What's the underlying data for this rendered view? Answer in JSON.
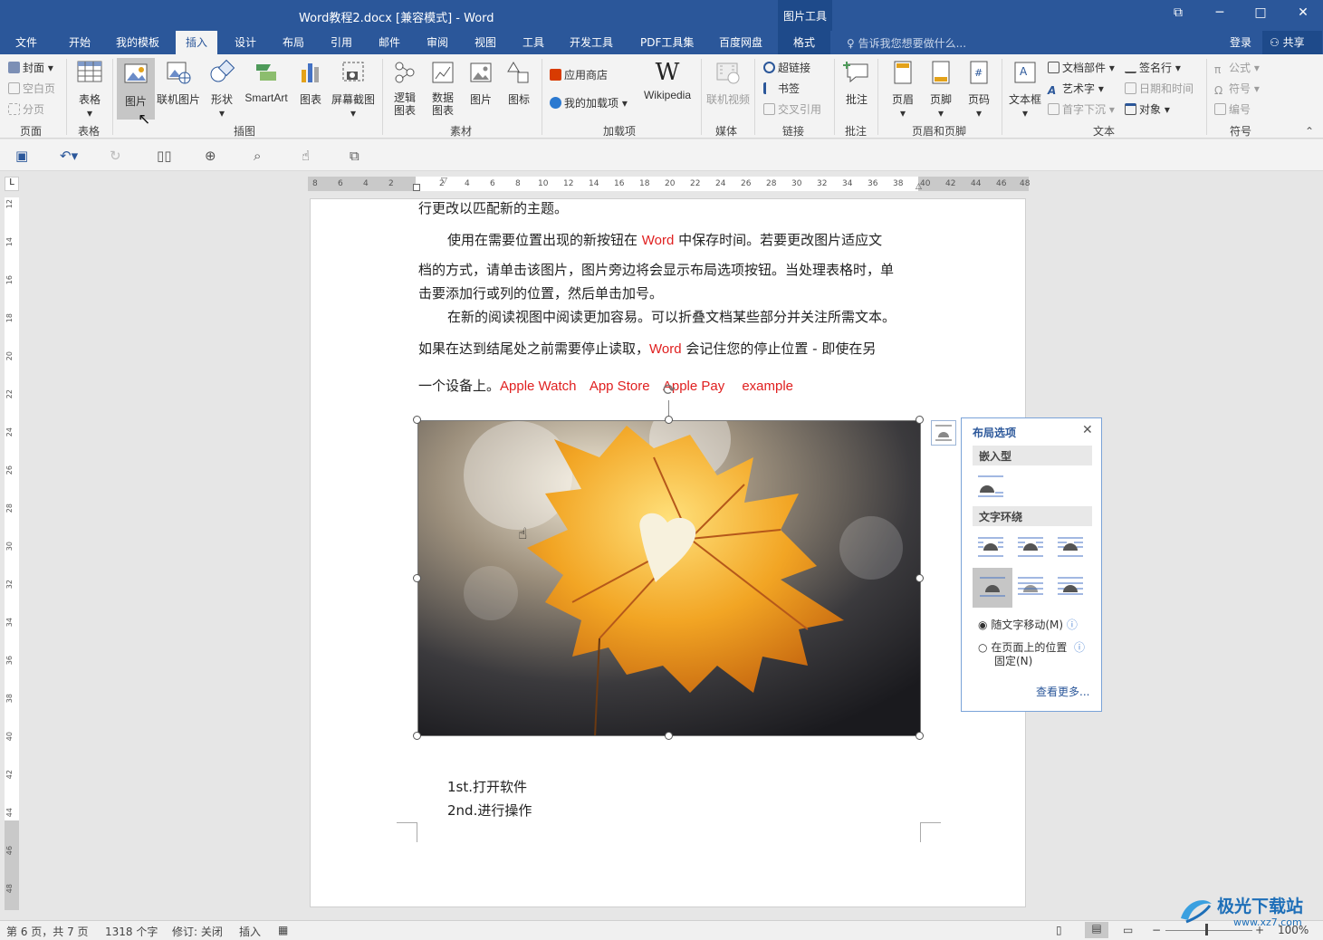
{
  "window": {
    "title": "Word教程2.docx [兼容模式] - Word",
    "context_tab": "图片工具",
    "restore_icon": "⧉",
    "minimize_icon": "─",
    "maximize_icon": "□",
    "close_icon": "✕"
  },
  "tabs": [
    "文件",
    "开始",
    "我的模板",
    "插入",
    "设计",
    "布局",
    "引用",
    "邮件",
    "审阅",
    "视图",
    "工具",
    "开发工具",
    "PDF工具集",
    "百度网盘"
  ],
  "format_tab": "格式",
  "tell_me": "告诉我您想要做什么...",
  "login": "登录",
  "share": "共享",
  "ribbon": {
    "pages": {
      "cover": "封面",
      "blank": "空白页",
      "break": "分页",
      "label": "页面"
    },
    "table": {
      "table": "表格",
      "label": "表格"
    },
    "illus": {
      "picture": "图片",
      "online": "联机图片",
      "shapes": "形状",
      "smartart": "SmartArt",
      "chart": "图表",
      "screenshot": "屏幕截图",
      "label": "插图"
    },
    "material": {
      "logic": "逻辑\n图表",
      "data": "数据\n图表",
      "picture": "图片",
      "icon": "图标",
      "label": "素材"
    },
    "addins": {
      "store": "应用商店",
      "mine": "我的加载项",
      "wiki": "Wikipedia",
      "label": "加载项"
    },
    "media": {
      "video": "联机视频",
      "label": "媒体"
    },
    "links": {
      "hyper": "超链接",
      "bookmark": "书签",
      "cross": "交叉引用",
      "label": "链接"
    },
    "comments": {
      "comment": "批注",
      "label": "批注"
    },
    "hf": {
      "header": "页眉",
      "footer": "页脚",
      "number": "页码",
      "label": "页眉和页脚"
    },
    "text": {
      "textbox": "文本框",
      "parts": "文档部件",
      "wordart": "艺术字",
      "dropcap": "首字下沉",
      "sign": "签名行",
      "datetime": "日期和时间",
      "object": "对象",
      "label": "文本"
    },
    "symbols": {
      "equation": "公式",
      "symbol": "符号",
      "number": "编号",
      "label": "符号"
    }
  },
  "ruler_h": [
    "8",
    "6",
    "4",
    "2",
    "",
    "2",
    "4",
    "6",
    "8",
    "10",
    "12",
    "14",
    "16",
    "18",
    "20",
    "22",
    "24",
    "26",
    "28",
    "30",
    "32",
    "34",
    "36",
    "38",
    "40",
    "42",
    "44",
    "46",
    "48"
  ],
  "ruler_v": [
    "12",
    "14",
    "16",
    "18",
    "20",
    "22",
    "24",
    "26",
    "28",
    "30",
    "32",
    "34",
    "36",
    "38",
    "40",
    "42",
    "44",
    "46",
    "48"
  ],
  "doc": {
    "l1": "行更改以匹配新的主题。",
    "l2a": "使用在需要位置出现的新按钮在",
    "l2w": "Word",
    "l2b": "中保存时间。若要更改图片适应文",
    "l3": "档的方式，请单击该图片，图片旁边将会显示布局选项按钮。当处理表格时，单",
    "l4": "击要添加行或列的位置，然后单击加号。",
    "l5": "在新的阅读视图中阅读更加容易。可以折叠文档某些部分并关注所需文本。",
    "l6a": "如果在达到结尾处之前需要停止读取，",
    "l6w": "Word",
    "l6b": "会记住您的停止位置  - 即使在另",
    "l7a": "一个设备上。",
    "l7b": "Apple Watch",
    "l7c": "App Store",
    "l7d": "Apple Pay",
    "l7e": "example",
    "list1": "1st.打开软件",
    "list2": "2nd.进行操作"
  },
  "layout_panel": {
    "title": "布局选项",
    "close": "✕",
    "inline": "嵌入型",
    "wrap": "文字环绕",
    "opt1": "随文字移动(M)",
    "opt2a": "在页面上的位置",
    "opt2b": "固定(N)",
    "more": "查看更多...",
    "selected_option": "随文字移动(M)"
  },
  "status": {
    "page": "第 6 页，共 7 页",
    "words": "1318 个字",
    "track": "修订: 关闭",
    "mode": "插入",
    "zoom": "100%"
  },
  "watermark": {
    "brand": "极光下载站",
    "url": "www.xz7.com"
  },
  "colors": {
    "brand": "#2b579a",
    "red_text": "#e02020",
    "panel_border": "#7aa3d8"
  }
}
